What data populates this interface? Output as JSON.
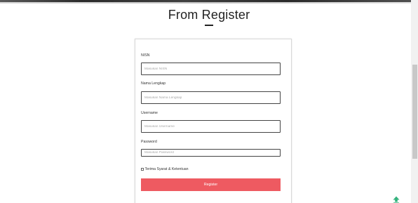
{
  "page": {
    "title": "From Register"
  },
  "form": {
    "nisn": {
      "label": "NISN",
      "placeholder": "Masukan NISN",
      "value": ""
    },
    "nama_lengkap": {
      "label": "Nama Lengkap",
      "placeholder": "Masukan Nama Lengkap",
      "value": ""
    },
    "username": {
      "label": "Username",
      "placeholder": "Masukan Username",
      "value": ""
    },
    "password": {
      "label": "Password",
      "placeholder": "Masukan Password",
      "value": ""
    },
    "terms": {
      "label": "Terima Syarat & Ketentuan",
      "checked": false
    },
    "submit_label": "Register"
  },
  "icons": {
    "scroll_top": "arrow-up-to-line-icon"
  },
  "colors": {
    "accent": "#ee5a61",
    "scroll_top_icon": "#34b27d"
  }
}
